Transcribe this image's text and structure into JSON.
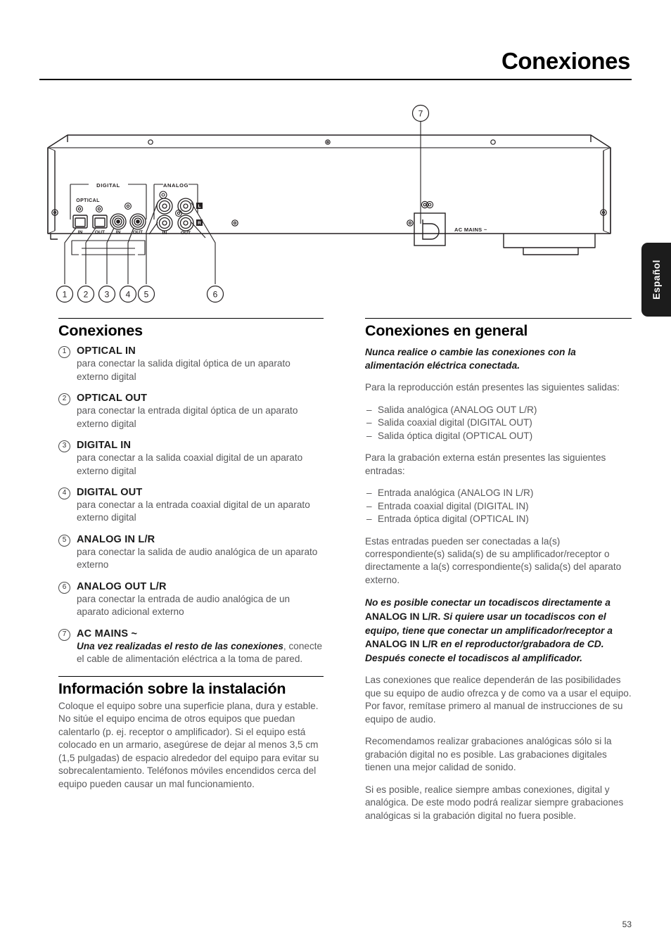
{
  "header": {
    "title": "Conexiones"
  },
  "language_tab": {
    "label": "Español"
  },
  "figure": {
    "group_digital_label": "DIGITAL",
    "group_analog_label": "ANALOG",
    "optical_label": "OPTICAL",
    "optical_in_label": "IN",
    "optical_out_label": "OUT",
    "coax_in_label": "IN",
    "coax_out_label": "OUT",
    "analog_in_label": "IN",
    "analog_out_label": "OUT",
    "channel_left_label": "L",
    "channel_right_label": "R",
    "ac_mains_label": "AC MAINS ~",
    "callouts": [
      "1",
      "2",
      "3",
      "4",
      "5",
      "6",
      "7"
    ]
  },
  "left_column": {
    "section_title": "Conexiones",
    "items": [
      {
        "num": "1",
        "term": "OPTICAL IN",
        "desc": "para conectar la salida digital óptica de un aparato externo digital"
      },
      {
        "num": "2",
        "term": "OPTICAL OUT",
        "desc": "para conectar la entrada digital óptica de un aparato externo digital"
      },
      {
        "num": "3",
        "term": "DIGITAL IN",
        "desc": "para conectar a la salida coaxial digital de un aparato externo digital"
      },
      {
        "num": "4",
        "term": "DIGITAL OUT",
        "desc": "para conectar a la entrada coaxial digital de un aparato externo digital"
      },
      {
        "num": "5",
        "term": "ANALOG IN L/R",
        "desc": "para conectar la salida de audio analógica de un aparato externo"
      },
      {
        "num": "6",
        "term": "ANALOG OUT L/R",
        "desc": "para conectar la entrada de audio analógica de un aparato adicional externo"
      },
      {
        "num": "7",
        "term": "AC MAINS ~",
        "desc_bold": "Una vez realizadas el resto de las conexiones",
        "desc_rest": ", conecte el cable de alimentación eléctrica a la toma de pared."
      }
    ],
    "install_title": "Información sobre la instalación",
    "install_body": "Coloque el equipo sobre una superficie plana, dura y estable. No sitúe el equipo encima de otros equipos que puedan calentarlo (p. ej. receptor o amplificador). Si el equipo está colocado en un armario, asegúrese de dejar al menos 3,5 cm (1,5 pulgadas) de espacio alrededor del equipo para evitar su sobrecalentamiento. Teléfonos móviles encendidos cerca del equipo pueden causar un mal funcionamiento."
  },
  "right_column": {
    "section_title": "Conexiones en general",
    "warning_power": "Nunca realice o cambie las conexiones con la alimentación eléctrica conectada.",
    "playback_intro": "Para la reproducción están presentes las siguientes salidas:",
    "playback_list": [
      "Salida analógica (ANALOG OUT L/R)",
      "Salida coaxial digital (DIGITAL OUT)",
      "Salida óptica digital (OPTICAL OUT)"
    ],
    "recording_intro": "Para la grabación externa están presentes las siguientes entradas:",
    "recording_list": [
      "Entrada analógica (ANALOG IN L/R)",
      "Entrada coaxial digital (DIGITAL IN)",
      "Entrada óptica digital (OPTICAL IN)"
    ],
    "inputs_para": "Estas entradas pueden ser conectadas a la(s) correspondiente(s) salida(s) de su amplificador/receptor o directamente a la(s) correspondiente(s) salida(s) del aparato externo.",
    "turntable_warning": {
      "part1": "No es posible conectar un tocadiscos directamente a ",
      "up1": "ANALOG IN L/R.",
      "part2": " Si quiere usar un tocadiscos con el equipo, tiene que conectar un amplificador/receptor a ",
      "up2": "ANALOG IN L/R",
      "part3": " en el reproductor/grabadora de CD. Después conecte el tocadiscos al amplificador."
    },
    "paragraph_depends": "Las conexiones que realice dependerán de las posibilidades que su equipo de audio ofrezca y de como va a usar el equipo. Por favor, remítase primero al manual de instrucciones de su equipo de audio.",
    "paragraph_recommend": "Recomendamos realizar grabaciones analógicas sólo si la grabación digital no es posible. Las grabaciones digitales tienen una mejor calidad de sonido.",
    "paragraph_both": "Si es posible, realice siempre ambas conexiones, digital y analógica. De este modo podrá realizar siempre grabaciones analógicas si la grabación digital no fuera posible."
  },
  "footer": {
    "page_number": "53"
  }
}
